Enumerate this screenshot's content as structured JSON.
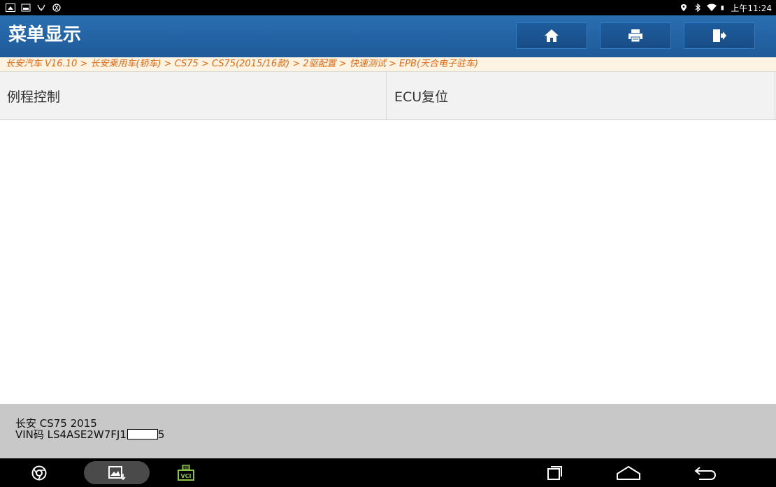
{
  "status_bar": {
    "time": "上午11:24",
    "left_icons": [
      "notification-icon",
      "screenshot-icon",
      "usb-icon",
      "settings-notification-icon"
    ],
    "right_icons": [
      "location-icon",
      "bluetooth-icon",
      "wifi-icon",
      "battery-icon"
    ]
  },
  "header": {
    "title": "菜单显示",
    "buttons": [
      {
        "name": "home",
        "icon": "home-icon"
      },
      {
        "name": "print",
        "icon": "printer-icon"
      },
      {
        "name": "exit",
        "icon": "exit-icon"
      }
    ]
  },
  "breadcrumb": "长安汽车 V16.10 > 长安乘用车(轿车) > CS75 > CS75(2015/16款) > 2驱配置 > 快速测试 > EPB(天合电子驻车)",
  "menu": {
    "items": [
      {
        "label": "例程控制"
      },
      {
        "label": "ECU复位"
      }
    ]
  },
  "footer": {
    "vehicle": "长安 CS75 2015",
    "vin": "VIN码 LS4ASE2W7FJ1",
    "vin_tail": "5"
  },
  "colors": {
    "header_blue": "#1f5a99",
    "breadcrumb_text": "#e06a14",
    "breadcrumb_bg": "#fdf3e2",
    "menu_bg": "#f2f2f2",
    "footer_bg": "#c8c8c8",
    "vci_green": "#8bc34a"
  }
}
